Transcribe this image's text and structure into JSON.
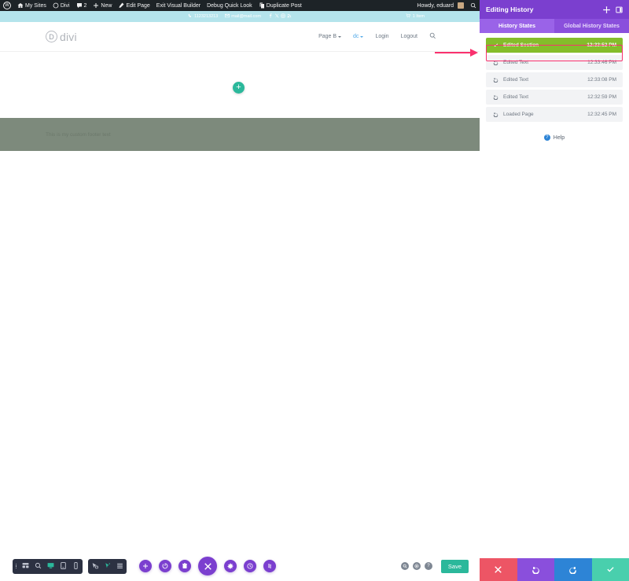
{
  "admin_bar": {
    "wp_logo": "wordpress-logo",
    "items": [
      {
        "label": "My Sites",
        "icon": "sites-icon"
      },
      {
        "label": "Divi",
        "icon": "divi-icon"
      },
      {
        "label": "2",
        "icon": "comment-icon"
      },
      {
        "label": "New",
        "icon": "plus-icon"
      },
      {
        "label": "Edit Page",
        "icon": "pencil-icon"
      },
      {
        "label": "Exit Visual Builder",
        "icon": ""
      },
      {
        "label": "Debug Quick Look",
        "icon": ""
      },
      {
        "label": "Duplicate Post",
        "icon": "duplicate-icon"
      }
    ],
    "greeting": "Howdy, eduard",
    "search_icon": "search-icon"
  },
  "site_topbar": {
    "phone": "1123213213",
    "email": "mail@mail.com",
    "socials": [
      "facebook-icon",
      "x-icon",
      "instagram-icon",
      "rss-icon"
    ],
    "cart_label": "1 Item",
    "background": "#b4e4ec"
  },
  "site_header": {
    "logo_letter": "D",
    "logo_text": "divi",
    "nav": [
      {
        "label": "Page B",
        "has_caret": true,
        "accent": false
      },
      {
        "label": "dc",
        "has_caret": true,
        "accent": true
      },
      {
        "label": "Login",
        "has_caret": false,
        "accent": false
      },
      {
        "label": "Logout",
        "has_caret": false,
        "accent": false
      }
    ],
    "search_icon": "search-icon"
  },
  "canvas": {
    "add_section_label": "+",
    "footer_text": "This is my custom footer text",
    "footer_background": "#7d8a7c"
  },
  "builder_toolbar": {
    "group_one": [
      "vertical-dots-icon",
      "wireframe-icon",
      "zoom-icon",
      "desktop-icon",
      "tablet-icon",
      "phone-icon"
    ],
    "group_two": [
      "click-mode-icon",
      "hover-mode-icon",
      "list-view-icon"
    ],
    "circle_buttons": [
      {
        "icon": "plus-icon",
        "size": "small"
      },
      {
        "icon": "power-icon",
        "size": "small"
      },
      {
        "icon": "trash-icon",
        "size": "small"
      },
      {
        "icon": "close-icon",
        "size": "large"
      },
      {
        "icon": "gear-icon",
        "size": "small"
      },
      {
        "icon": "history-clock-icon",
        "size": "small"
      },
      {
        "icon": "portability-icon",
        "size": "small"
      }
    ],
    "right_icons": [
      "search-icon",
      "settings-icon",
      "help-icon"
    ],
    "save_label": "Save",
    "save_color": "#2bb89b"
  },
  "history_panel": {
    "title": "Editing History",
    "header_icons": [
      "move-icon",
      "snap-right-icon"
    ],
    "tabs": [
      {
        "label": "History States",
        "active": true
      },
      {
        "label": "Global History States",
        "active": false
      }
    ],
    "states": [
      {
        "label": "Edited Section",
        "time": "12:33:52 PM",
        "active": true,
        "icon": "check-icon"
      },
      {
        "label": "Edited Text",
        "time": "12:33:46 PM",
        "active": false,
        "icon": "undo-icon"
      },
      {
        "label": "Edited Text",
        "time": "12:33:08 PM",
        "active": false,
        "icon": "undo-icon"
      },
      {
        "label": "Edited Text",
        "time": "12:32:59 PM",
        "active": false,
        "icon": "undo-icon"
      },
      {
        "label": "Loaded Page",
        "time": "12:32:45 PM",
        "active": false,
        "icon": "undo-icon"
      }
    ],
    "help_label": "Help",
    "actions": [
      {
        "name": "cancel",
        "icon": "close-icon",
        "color": "#ed5565"
      },
      {
        "name": "undo",
        "icon": "undo-icon",
        "color": "#8a4fdc"
      },
      {
        "name": "redo",
        "icon": "redo-icon",
        "color": "#2d84d6"
      },
      {
        "name": "apply",
        "icon": "check-icon",
        "color": "#49cfad"
      }
    ],
    "accent_color": "#7b3fcf",
    "active_state_color": "#84bd2a",
    "highlight_outline_color": "#f9316e"
  },
  "annotation": {
    "arrow_color": "#f9316e",
    "points_to": "Edited Section"
  }
}
